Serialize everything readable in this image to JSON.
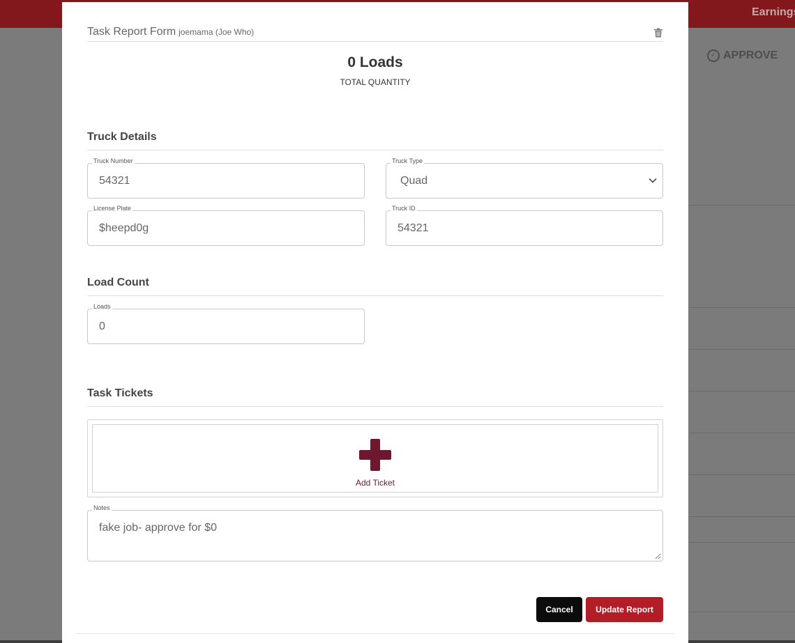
{
  "background": {
    "topbar_link": "Earnings",
    "approve_label": "APPROVE"
  },
  "form": {
    "title": "Task Report Form",
    "user": "joemama (Joe Who)",
    "total_value": "0 Loads",
    "total_label": "TOTAL QUANTITY"
  },
  "truck_details": {
    "title": "Truck Details",
    "truck_number": {
      "label": "Truck Number",
      "value": "54321"
    },
    "truck_type": {
      "label": "Truck Type",
      "value": "Quad"
    },
    "license_plate": {
      "label": "License Plate",
      "value": "$heepd0g"
    },
    "truck_id": {
      "label": "Truck ID",
      "value": "54321"
    }
  },
  "load_count": {
    "title": "Load Count",
    "loads": {
      "label": "Loads",
      "value": "0"
    }
  },
  "task_tickets": {
    "title": "Task Tickets",
    "add_label": "Add Ticket"
  },
  "notes": {
    "label": "Notes",
    "value": "fake job- approve for $0"
  },
  "actions": {
    "cancel": "Cancel",
    "update": "Update Report"
  },
  "colors": {
    "brand": "#82171c",
    "primary_button": "#b21d27",
    "ticket_accent": "#6e1830"
  },
  "icons": [
    "trash-icon",
    "chevron-down-icon",
    "plus-icon",
    "check-circle-icon"
  ]
}
